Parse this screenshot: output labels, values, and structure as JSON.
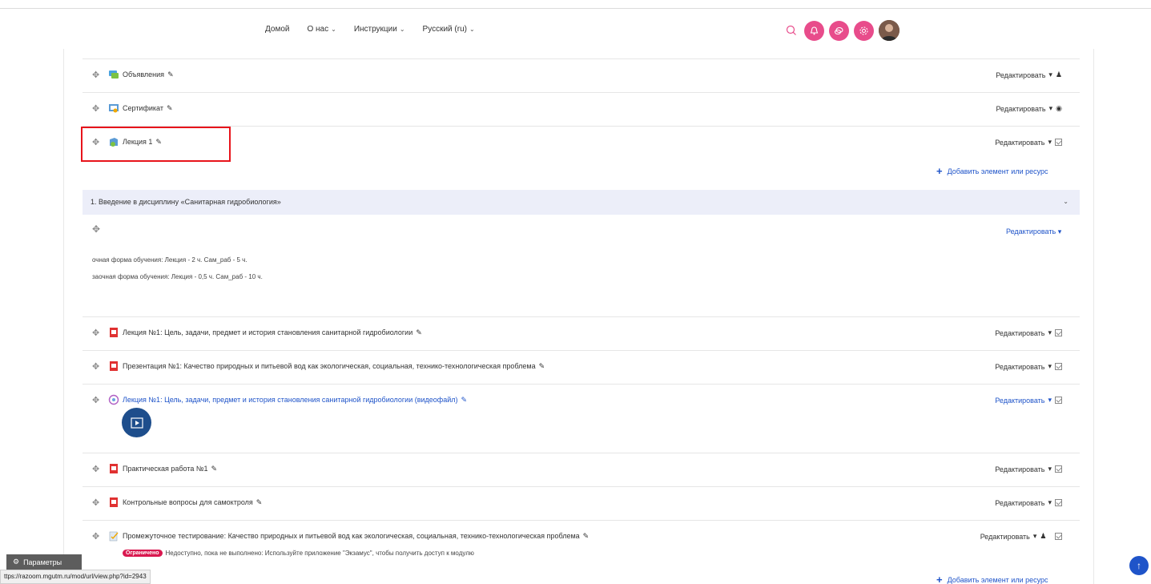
{
  "nav": {
    "home": "Домой",
    "about": "О нас",
    "instructions": "Инструкции",
    "language": "Русский (ru)"
  },
  "top_items": [
    {
      "label": "Объявления",
      "edit": "Редактировать"
    },
    {
      "label": "Сертификат",
      "edit": "Редактировать"
    },
    {
      "label": "Лекция 1",
      "edit": "Редактировать"
    }
  ],
  "add_resource": "Добавить элемент или ресурс",
  "section": {
    "title": "1. Введение в дисциплину «Санитарная гидробиология»",
    "edit": "Редактировать",
    "line1": "очная форма обучения: Лекция - 2 ч. Сам_раб - 5 ч.",
    "line2": "заочная форма обучения: Лекция - 0,5 ч. Сам_раб - 10 ч."
  },
  "section_items": [
    {
      "label": "Лекция №1: Цель, задачи, предмет и история становления санитарной гидробиологии",
      "edit": "Редактировать"
    },
    {
      "label": "Презентация №1: Качество природных и питьевой вод как экологическая, социальная, технико-технологическая проблема",
      "edit": "Редактировать"
    },
    {
      "label": "Лекция №1: Цель, задачи, предмет и история становления санитарной гидробиологии (видеофайл)",
      "edit": "Редактировать"
    },
    {
      "label": "Практическая работа №1",
      "edit": "Редактировать"
    },
    {
      "label": "Контрольные вопросы для самоктроля",
      "edit": "Редактировать"
    },
    {
      "label": "Промежуточное тестирование: Качество природных и питьевой вод как экологическая, социальная, технико-технологическая проблема",
      "edit": "Редактировать"
    }
  ],
  "restriction": {
    "badge": "Ограничено",
    "text": "Недоступно, пока не выполнено: Используйте приложение \"Экзамус\", чтобы получить доступ к модулю"
  },
  "params_label": "Параметры",
  "status_url": "ttps://razoom.mgutm.ru/mod/url/view.php?id=2943",
  "colors": {
    "accent_pink": "#e84c8b",
    "link_blue": "#1f54c9",
    "restricted_red": "#d9184f",
    "highlight_box": "#e8141b"
  }
}
